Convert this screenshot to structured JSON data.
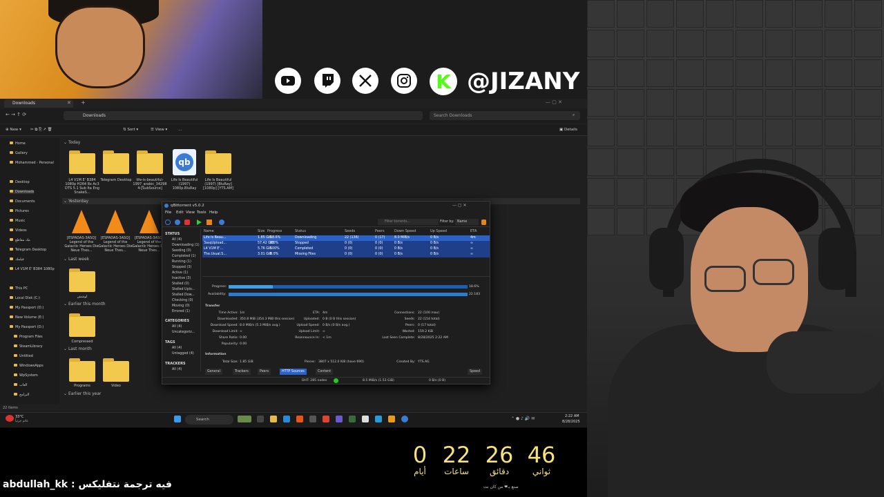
{
  "overlay": {
    "handle": "@JIZANY",
    "social_icons": [
      "youtube-icon",
      "twitch-icon",
      "x-icon",
      "instagram-icon",
      "kick-icon"
    ],
    "countdown": [
      {
        "value": "0",
        "label": "أيام"
      },
      {
        "value": "22",
        "label": "ساعات"
      },
      {
        "value": "26",
        "label": "دقائق"
      },
      {
        "value": "46",
        "label": "ثواني"
      }
    ],
    "chat": "abdullah_kk : فيه ترجمة نتفليكس",
    "footer": "صنع بـ❤ من كان نت",
    "colors": {
      "countdown": "#f7e27a",
      "kick": "#53fc18"
    }
  },
  "explorer": {
    "tab": "Downloads",
    "address": "Downloads",
    "search_placeholder": "Search Downloads",
    "cmd": {
      "new": "New",
      "sort": "Sort",
      "view": "View",
      "more": "...",
      "details": "Details"
    },
    "nav": [
      "Home",
      "Gallery",
      "Mohammed - Personal",
      "Desktop",
      "Downloads",
      "Documents",
      "Pictures",
      "Music",
      "Videos",
      "مك مقاطع",
      "Telegram Desktop",
      "فيلمك",
      "L4 V1M E' B384 1080p",
      "This PC",
      "Local Disk (C:)",
      "My Passport (D:)",
      "New Volume (E:)",
      "My Passport (D:)",
      "Program Files",
      "SteamLibrary",
      "Untitled",
      "WindowsApps",
      "WpSystem",
      "العاب",
      "البرامج"
    ],
    "sections": {
      "today": "Today",
      "yesterday": "Yesterday",
      "last_week": "Last week",
      "earlier_month": "Earlier this month",
      "last_month": "Last month",
      "earlier_year": "Earlier this year"
    },
    "today_items": [
      "L4 V1M E' B384 1080p H264 8x Ac3 DTS 5.1 Sub Ita Eng SnakeS...",
      "Telegram Desktop",
      "life-is-beautiful-1997_arabic_34298 4-[SubSource]",
      "Life Is Beautiful (1997) 1080p.BluRay",
      "Life Is Beautiful (1997) [BluRay] [1080p] [YTS.AM]"
    ],
    "yesterday_items": [
      "[ESPADAS-3ASQ] Legend of the Galactic Heroes Die Neue Thes...",
      "[ESPADAS-3ASQ] Legend of the Galactic Heroes Die Neue Thes...",
      "[ESPADAS-3ASQ] Legend of the Galactic Heroes Die Neue Thes..."
    ],
    "last_week_item": "لوشش",
    "earlier_month_item": "Compressed",
    "last_month_items": [
      "Programs",
      "Video"
    ],
    "status": "22 items"
  },
  "qbittorrent": {
    "title": "qBittorrent v5.0.2",
    "menu": [
      "File",
      "Edit",
      "View",
      "Tools",
      "Help"
    ],
    "filter_placeholder": "Filter torrents...",
    "filter_by": "Filter by:",
    "filter_value": "Name",
    "sidebar": {
      "status_header": "STATUS",
      "status": [
        "All (4)",
        "Downloading (1)",
        "Seeding (0)",
        "Completed (1)",
        "Running (1)",
        "Stopped (3)",
        "Active (1)",
        "Inactive (3)",
        "Stalled (0)",
        "Stalled Uplo...",
        "Stalled Dow...",
        "Checking (0)",
        "Moving (0)",
        "Errored (1)"
      ],
      "categories_header": "CATEGORIES",
      "categories": [
        "All (4)",
        "Uncategoriz..."
      ],
      "tags_header": "TAGS",
      "tags": [
        "All (4)",
        "Untagged (4)"
      ],
      "trackers_header": "TRACKERS",
      "trackers": [
        "All (4)"
      ]
    },
    "columns": [
      "Name",
      "Size",
      "Progress",
      "Status",
      "Seeds",
      "Peers",
      "Down Speed",
      "Up Speed",
      "ETA"
    ],
    "rows": [
      {
        "name": "Life Is Beau...",
        "size": "1.85 GiB",
        "progress": "18.6%",
        "status": "Downloading",
        "seeds": "22 (136)",
        "peers": "0 (17)",
        "down": "8.0 MiB/s",
        "up": "0 B/s",
        "eta": "4m",
        "color": "#2a62c9"
      },
      {
        "name": "3asqUpload...",
        "size": "57.42 GiB",
        "progress": "0.0%",
        "status": "Stopped",
        "seeds": "0 (0)",
        "peers": "0 (0)",
        "down": "0 B/s",
        "up": "0 B/s",
        "eta": "∞",
        "color": "#1f3f8a"
      },
      {
        "name": "L4 V1M E'...",
        "size": "5.76 GiB",
        "progress": "100%",
        "status": "Completed",
        "seeds": "0 (0)",
        "peers": "0 (0)",
        "down": "0 B/s",
        "up": "0 B/s",
        "eta": "∞",
        "color": "#1f3f8a"
      },
      {
        "name": "The.Usual.S...",
        "size": "3.01 GiB",
        "progress": "0.0%",
        "status": "Missing Files",
        "seeds": "0 (0)",
        "peers": "0 (0)",
        "down": "0 B/s",
        "up": "0 B/s",
        "eta": "∞",
        "color": "#1f3f8a"
      }
    ],
    "progress_label": "Progress:",
    "progress_value": "18.6%",
    "progress_fraction": 0.186,
    "availability_label": "Availability:",
    "availability_value": "22.183",
    "transfer_header": "Transfer",
    "transfer": {
      "time_active": [
        "Time Active:",
        "1m"
      ],
      "downloaded": [
        "Downloaded:",
        "350.8 MiB (354.3 MiB this session)"
      ],
      "download_speed": [
        "Download Speed:",
        "8.0 MiB/s (5.3 MiB/s avg.)"
      ],
      "download_limit": [
        "Download Limit:",
        "∞"
      ],
      "share_ratio": [
        "Share Ratio:",
        "0.00"
      ],
      "popularity": [
        "Popularity:",
        "0.00"
      ],
      "eta": [
        "ETA:",
        "4m"
      ],
      "uploaded": [
        "Uploaded:",
        "0 B (0 B this session)"
      ],
      "upload_speed": [
        "Upload Speed:",
        "0 B/s (0 B/s avg.)"
      ],
      "upload_limit": [
        "Upload Limit:",
        "∞"
      ],
      "reannounce": [
        "Reannounce In:",
        "< 1m"
      ],
      "connections": [
        "Connections:",
        "22 (100 max)"
      ],
      "seeds": [
        "Seeds:",
        "22 (154 total)"
      ],
      "peers": [
        "Peers:",
        "0 (17 total)"
      ],
      "wasted": [
        "Wasted:",
        "159.2 KiB"
      ],
      "last_seen": [
        "Last Seen Complete:",
        "8/28/2025 2:22 AM"
      ]
    },
    "info_header": "Information",
    "info": {
      "total_size": [
        "Total Size:",
        "1.85 GiB"
      ],
      "pieces": [
        "Pieces:",
        "3807 x 512.0 KiB (have 690)"
      ],
      "created_by": [
        "Created By:",
        "YTS.AG"
      ]
    },
    "tabs": [
      "General",
      "Trackers",
      "Peers",
      "HTTP Sources",
      "Content",
      "Speed"
    ],
    "statusbar": {
      "dht": "DHT: 285 nodes",
      "down": "8.5 MiB/s (1.53 GiB)",
      "up": "0 B/s (0 B)"
    }
  },
  "taskbar": {
    "weather": "33°C",
    "weather_sub": "غائم جزئياً",
    "search": "Search",
    "time": "2:22 AM",
    "date": "8/28/2025"
  }
}
